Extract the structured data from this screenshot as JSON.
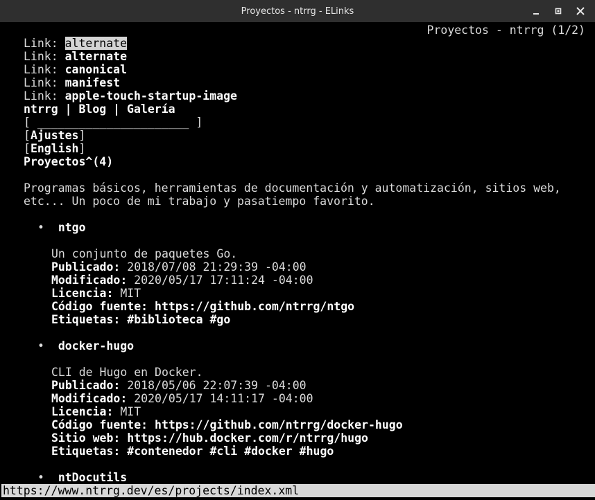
{
  "window": {
    "title": "Proyectos - ntrrg - ELinks"
  },
  "page": {
    "header_right": "Proyectos - ntrrg (1/2)",
    "link_prefix": "Link: ",
    "links": [
      "alternate",
      "alternate",
      "canonical",
      "manifest",
      "apple-touch-startup-image"
    ],
    "nav": [
      "ntrrg",
      "Blog",
      "Galería"
    ],
    "nav_sep": " | ",
    "search_field": "[ ______________________ ]",
    "button_ajustes": "Ajustes",
    "button_english": "English",
    "heading": "Proyectos^(4)",
    "intro_line1": "Programas básicos, herramientas de documentación y automatización, sitios web,",
    "intro_line2": "etc... Un poco de mi trabajo y pasatiempo favorito.",
    "bullet": "•",
    "labels": {
      "publicado": "Publicado:",
      "modificado": "Modificado:",
      "licencia": "Licencia:",
      "codigo": "Código fuente:",
      "sitio": "Sitio web:",
      "etiquetas": "Etiquetas:"
    },
    "projects": [
      {
        "name": "ntgo",
        "description": "Un conjunto de paquetes Go.",
        "publicado": "2018/07/08 21:29:39 -04:00",
        "modificado": "2020/05/17 17:11:24 -04:00",
        "licencia": "MIT",
        "codigo": "https://github.com/ntrrg/ntgo",
        "tags": [
          "#biblioteca",
          "#go"
        ]
      },
      {
        "name": "docker-hugo",
        "description": "CLI de Hugo en Docker.",
        "publicado": "2018/05/06 22:07:39 -04:00",
        "modificado": "2020/05/17 14:11:17 -04:00",
        "licencia": "MIT",
        "codigo": "https://github.com/ntrrg/docker-hugo",
        "sitio": "https://hub.docker.com/r/ntrrg/hugo",
        "tags": [
          "#contenedor",
          "#cli",
          "#docker",
          "#hugo"
        ]
      },
      {
        "name": "ntDocutils"
      }
    ]
  },
  "statusbar": {
    "url": "https://www.ntrrg.dev/es/projects/index.xml"
  },
  "colors": {
    "background": "#000000",
    "text": "#dcdcdc",
    "bold_text": "#ffffff",
    "titlebar": "#2f2f2f",
    "statusbar": "#d8d8d8"
  }
}
